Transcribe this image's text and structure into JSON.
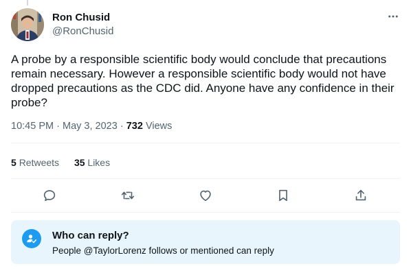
{
  "author": {
    "display_name": "Ron Chusid",
    "handle": "@RonChusid"
  },
  "tweet": {
    "text": "A probe by a responsible scientific body would conclude that precautions remain necessary. However a responsible scientific body would not have dropped precautions as the CDC did. Anyone have any confidence in their probe?",
    "time": "10:45 PM",
    "separator": "·",
    "date": "May 3, 2023",
    "views_count": "732",
    "views_label": "Views"
  },
  "stats": {
    "retweets_count": "5",
    "retweets_label": "Retweets",
    "likes_count": "35",
    "likes_label": "Likes"
  },
  "actions": [
    "reply-icon",
    "retweet-icon",
    "like-icon",
    "bookmark-icon",
    "share-icon"
  ],
  "reply_restriction": {
    "title": "Who can reply?",
    "description": "People @TaylorLorenz follows or mentioned can reply"
  },
  "colors": {
    "accent": "#1d9bf0",
    "text_secondary": "#536471",
    "reply_box_bg": "#e8f5fd"
  }
}
